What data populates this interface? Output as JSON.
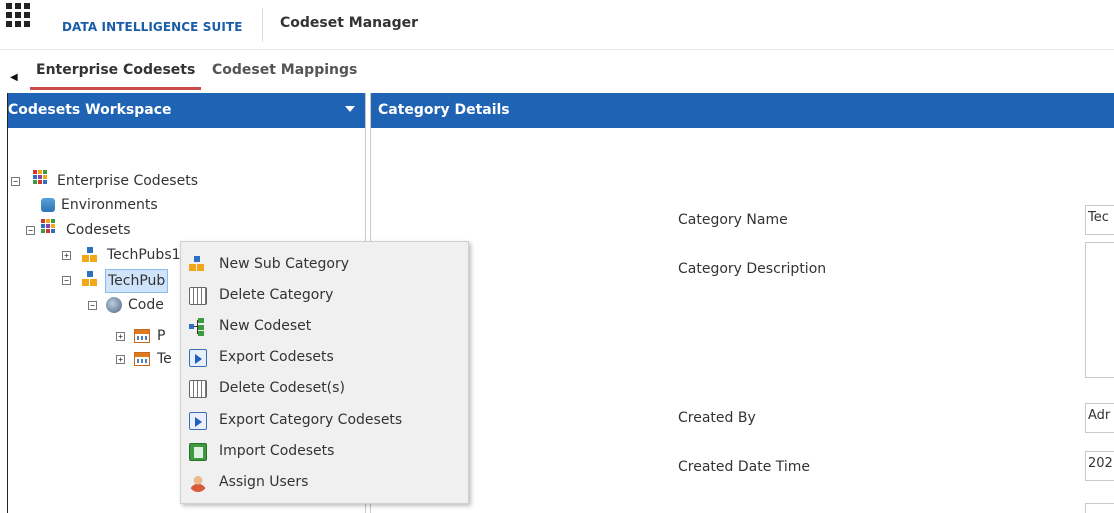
{
  "header": {
    "suite_name": "DATA INTELLIGENCE SUITE",
    "page_title": "Codeset Manager"
  },
  "tabs": [
    {
      "label": "Enterprise Codesets",
      "active": true
    },
    {
      "label": "Codeset Mappings",
      "active": false
    }
  ],
  "left_panel": {
    "title": "Codesets Workspace",
    "tree": {
      "root": "Enterprise Codesets",
      "environments": "Environments",
      "codesets": "Codesets",
      "techpubs1": "TechPubs1",
      "techpubs_selected": "TechPub",
      "codes_child": "Code",
      "table1": "P",
      "table2": "Te"
    }
  },
  "right_panel": {
    "title": "Category Details",
    "fields": {
      "category_name_label": "Category Name",
      "category_name_value": "Tec",
      "category_description_label": "Category Description",
      "created_by_label": "Created By",
      "created_by_value": "Adr",
      "created_date_label": "Created Date Time",
      "created_date_value": "202"
    }
  },
  "context_menu": {
    "items": [
      {
        "label": "New Sub Category",
        "icon": "sub-category-icon"
      },
      {
        "label": "Delete Category",
        "icon": "trash-icon"
      },
      {
        "label": "New Codeset",
        "icon": "codeset-tree-icon"
      },
      {
        "label": "Export Codesets",
        "icon": "export-icon"
      },
      {
        "label": "Delete Codeset(s)",
        "icon": "trash-icon"
      },
      {
        "label": "Export Category Codesets",
        "icon": "export-icon"
      },
      {
        "label": "Import Codesets",
        "icon": "import-excel-icon"
      },
      {
        "label": "Assign Users",
        "icon": "user-icon"
      }
    ]
  },
  "colors": {
    "header_blue": "#1f64b4",
    "active_tab_underline": "#c94b4b",
    "suite_name": "#1a5ca8"
  }
}
